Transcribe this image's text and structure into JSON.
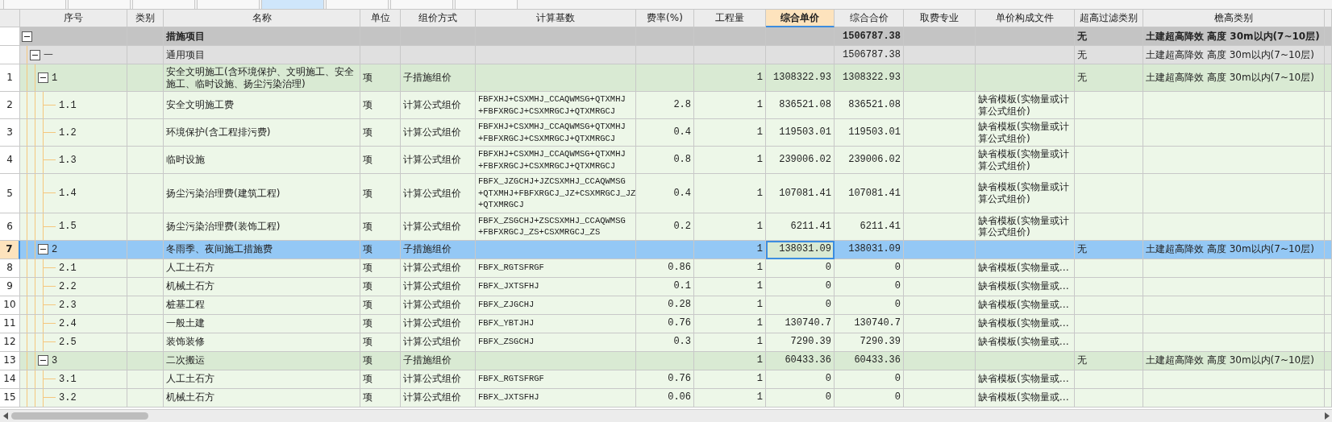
{
  "tabs": [
    {
      "selected": false
    },
    {
      "selected": false
    },
    {
      "selected": false
    },
    {
      "selected": false
    },
    {
      "selected": true
    },
    {
      "selected": false
    },
    {
      "selected": false
    },
    {
      "selected": false
    }
  ],
  "columns": [
    {
      "label": "序号",
      "selected": false
    },
    {
      "label": "类别",
      "selected": false
    },
    {
      "label": "名称",
      "selected": false
    },
    {
      "label": "单位",
      "selected": false
    },
    {
      "label": "组价方式",
      "selected": false
    },
    {
      "label": "计算基数",
      "selected": false
    },
    {
      "label": "费率(%)",
      "selected": false
    },
    {
      "label": "工程量",
      "selected": false
    },
    {
      "label": "综合单价",
      "selected": true
    },
    {
      "label": "综合合价",
      "selected": false
    },
    {
      "label": "取费专业",
      "selected": false
    },
    {
      "label": "单价构成文件",
      "selected": false
    },
    {
      "label": "超高过滤类别",
      "selected": false
    },
    {
      "label": "檐高类别",
      "selected": false
    }
  ],
  "rows": [
    {
      "kind": "group",
      "expanded": true,
      "selected": false,
      "name": "措施项目",
      "total": "1506787.38",
      "filter": "无",
      "height_class": "土建超高降效 高度 30m以内(7~10层)",
      "children": [
        {
          "kind": "section",
          "expanded": true,
          "selected": false,
          "seq": "一",
          "name": "通用项目",
          "total": "1506787.38",
          "filter": "无",
          "height_class": "土建超高降效 高度 30m以内(7~10层)",
          "children": [
            {
              "kind": "parent",
              "expanded": true,
              "selected": false,
              "row_no": "1",
              "seq": "1",
              "name": "安全文明施工(含环境保护、文明施工、安全施工、临时设施、扬尘污染治理)",
              "unit": "项",
              "method": "子措施组价",
              "quantity": "1",
              "unit_price": "1308322.93",
              "total": "1308322.93",
              "filter": "无",
              "height_class": "土建超高降效 高度 30m以内(7~10层)",
              "children": [
                {
                  "kind": "item",
                  "selected": false,
                  "row_no": "2",
                  "seq": "1.1",
                  "name": "安全文明施工费",
                  "unit": "项",
                  "method": "计算公式组价",
                  "basis": "FBFXHJ+CSXMHJ_CCAQWMSG+QTXMHJ\n+FBFXRGCJ+CSXMRGCJ+QTXMRGCJ",
                  "rate": "2.8",
                  "quantity": "1",
                  "unit_price": "836521.08",
                  "total": "836521.08",
                  "template": "缺省模板(实物量或计算公式组价)"
                },
                {
                  "kind": "item",
                  "selected": false,
                  "row_no": "3",
                  "seq": "1.2",
                  "name": "环境保护(含工程排污费)",
                  "unit": "项",
                  "method": "计算公式组价",
                  "basis": "FBFXHJ+CSXMHJ_CCAQWMSG+QTXMHJ\n+FBFXRGCJ+CSXMRGCJ+QTXMRGCJ",
                  "rate": "0.4",
                  "quantity": "1",
                  "unit_price": "119503.01",
                  "total": "119503.01",
                  "template": "缺省模板(实物量或计算公式组价)"
                },
                {
                  "kind": "item",
                  "selected": false,
                  "row_no": "4",
                  "seq": "1.3",
                  "name": "临时设施",
                  "unit": "项",
                  "method": "计算公式组价",
                  "basis": "FBFXHJ+CSXMHJ_CCAQWMSG+QTXMHJ\n+FBFXRGCJ+CSXMRGCJ+QTXMRGCJ",
                  "rate": "0.8",
                  "quantity": "1",
                  "unit_price": "239006.02",
                  "total": "239006.02",
                  "template": "缺省模板(实物量或计算公式组价)"
                },
                {
                  "kind": "item",
                  "selected": false,
                  "row_no": "5",
                  "seq": "1.4",
                  "name": "扬尘污染治理费(建筑工程)",
                  "unit": "项",
                  "method": "计算公式组价",
                  "basis": "FBFX_JZGCHJ+JZCSXMHJ_CCAQWMSG\n+QTXMHJ+FBFXRGCJ_JZ+CSXMRGCJ_JZ\n+QTXMRGCJ",
                  "rate": "0.4",
                  "quantity": "1",
                  "unit_price": "107081.41",
                  "total": "107081.41",
                  "template": "缺省模板(实物量或计算公式组价)"
                },
                {
                  "kind": "item",
                  "selected": false,
                  "row_no": "6",
                  "seq": "1.5",
                  "name": "扬尘污染治理费(装饰工程)",
                  "unit": "项",
                  "method": "计算公式组价",
                  "basis": "FBFX_ZSGCHJ+ZSCSXMHJ_CCAQWMSG\n+FBFXRGCJ_ZS+CSXMRGCJ_ZS",
                  "rate": "0.2",
                  "quantity": "1",
                  "unit_price": "6211.41",
                  "total": "6211.41",
                  "template": "缺省模板(实物量或计算公式组价)"
                }
              ]
            },
            {
              "kind": "parent",
              "expanded": true,
              "selected": true,
              "row_no": "7",
              "seq": "2",
              "name": "冬雨季、夜间施工措施费",
              "unit": "项",
              "method": "子措施组价",
              "quantity": "1",
              "unit_price": "138031.09",
              "total": "138031.09",
              "filter": "无",
              "height_class": "土建超高降效 高度 30m以内(7~10层)",
              "children": [
                {
                  "kind": "item",
                  "selected": false,
                  "row_no": "8",
                  "seq": "2.1",
                  "name": "人工土石方",
                  "unit": "项",
                  "method": "计算公式组价",
                  "basis": "FBFX_RGTSFRGF",
                  "rate": "0.86",
                  "quantity": "1",
                  "unit_price": "0",
                  "total": "0",
                  "template": "缺省模板(实物量或…"
                },
                {
                  "kind": "item",
                  "selected": false,
                  "row_no": "9",
                  "seq": "2.2",
                  "name": "机械土石方",
                  "unit": "项",
                  "method": "计算公式组价",
                  "basis": "FBFX_JXTSFHJ",
                  "rate": "0.1",
                  "quantity": "1",
                  "unit_price": "0",
                  "total": "0",
                  "template": "缺省模板(实物量或…"
                },
                {
                  "kind": "item",
                  "selected": false,
                  "row_no": "10",
                  "seq": "2.3",
                  "name": "桩基工程",
                  "unit": "项",
                  "method": "计算公式组价",
                  "basis": "FBFX_ZJGCHJ",
                  "rate": "0.28",
                  "quantity": "1",
                  "unit_price": "0",
                  "total": "0",
                  "template": "缺省模板(实物量或…"
                },
                {
                  "kind": "item",
                  "selected": false,
                  "row_no": "11",
                  "seq": "2.4",
                  "name": "一般土建",
                  "unit": "项",
                  "method": "计算公式组价",
                  "basis": "FBFX_YBTJHJ",
                  "rate": "0.76",
                  "quantity": "1",
                  "unit_price": "130740.7",
                  "total": "130740.7",
                  "template": "缺省模板(实物量或…"
                },
                {
                  "kind": "item",
                  "selected": false,
                  "row_no": "12",
                  "seq": "2.5",
                  "name": "装饰装修",
                  "unit": "项",
                  "method": "计算公式组价",
                  "basis": "FBFX_ZSGCHJ",
                  "rate": "0.3",
                  "quantity": "1",
                  "unit_price": "7290.39",
                  "total": "7290.39",
                  "template": "缺省模板(实物量或…"
                }
              ]
            },
            {
              "kind": "parent",
              "expanded": true,
              "selected": false,
              "row_no": "13",
              "seq": "3",
              "name": "二次搬运",
              "unit": "项",
              "method": "子措施组价",
              "quantity": "1",
              "unit_price": "60433.36",
              "total": "60433.36",
              "filter": "无",
              "height_class": "土建超高降效 高度 30m以内(7~10层)",
              "children": [
                {
                  "kind": "item",
                  "selected": false,
                  "row_no": "14",
                  "seq": "3.1",
                  "name": "人工土石方",
                  "unit": "项",
                  "method": "计算公式组价",
                  "basis": "FBFX_RGTSFRGF",
                  "rate": "0.76",
                  "quantity": "1",
                  "unit_price": "0",
                  "total": "0",
                  "template": "缺省模板(实物量或…"
                },
                {
                  "kind": "item",
                  "selected": false,
                  "row_no": "15",
                  "seq": "3.2",
                  "name": "机械土石方",
                  "unit": "项",
                  "method": "计算公式组价",
                  "basis": "FBFX_JXTSFHJ",
                  "rate": "0.06",
                  "quantity": "1",
                  "unit_price": "0",
                  "total": "0",
                  "template": "缺省模板(实物量或…"
                }
              ]
            }
          ]
        }
      ]
    }
  ]
}
